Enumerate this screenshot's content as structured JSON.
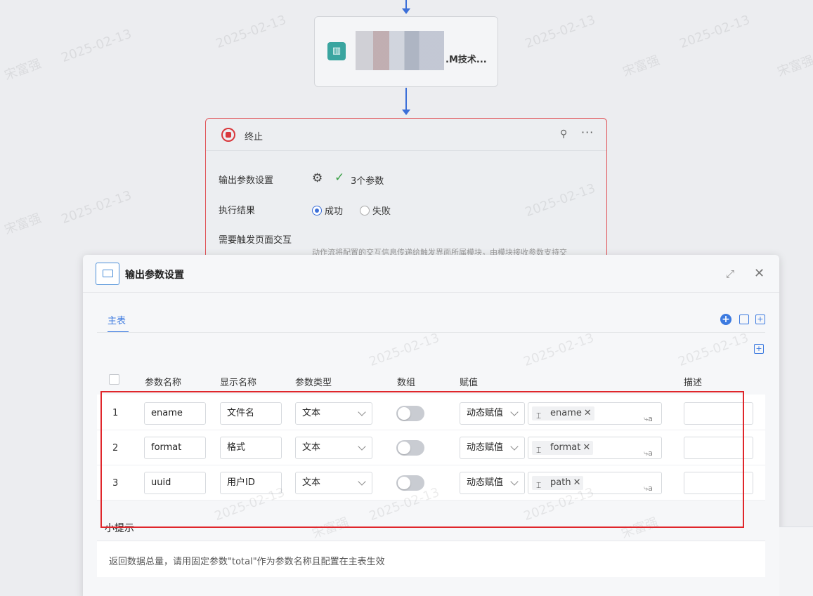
{
  "flow": {
    "card_title": ".M技术...",
    "end_node": {
      "title": "终止",
      "output_params_label": "输出参数设置",
      "param_count": "3个参数",
      "result_label": "执行结果",
      "result_success": "成功",
      "result_fail": "失败",
      "trigger_label": "需要触发页面交互",
      "trigger_desc": "动作流将配置的交互信息传递给触发界面所属模块，由模块接收参数支持交"
    }
  },
  "watermark": {
    "name": "宋富强",
    "date": "2025-02-13"
  },
  "modal": {
    "title": "输出参数设置",
    "tab": "主表",
    "table": {
      "headers": {
        "param_name": "参数名称",
        "display_name": "显示名称",
        "param_type": "参数类型",
        "array": "数组",
        "assign": "赋值",
        "desc": "描述"
      },
      "rows": [
        {
          "index": "1",
          "name": "ename",
          "display": "文件名",
          "type": "文本",
          "array_on": false,
          "assign_mode": "动态赋值",
          "value": "ename",
          "desc": ""
        },
        {
          "index": "2",
          "name": "format",
          "display": "格式",
          "type": "文本",
          "array_on": false,
          "assign_mode": "动态赋值",
          "value": "format",
          "desc": ""
        },
        {
          "index": "3",
          "name": "uuid",
          "display": "用户ID",
          "type": "文本",
          "array_on": false,
          "assign_mode": "动态赋值",
          "value": "path",
          "desc": ""
        }
      ]
    },
    "tip": {
      "title": "小提示",
      "text": "返回数据总量，请用固定参数\"total\"作为参数名称且配置在主表生效"
    }
  },
  "colors": {
    "accent": "#3c7ae0",
    "highlight": "#e0262b",
    "stop": "#d9383c",
    "teal": "#3aa5a0"
  }
}
